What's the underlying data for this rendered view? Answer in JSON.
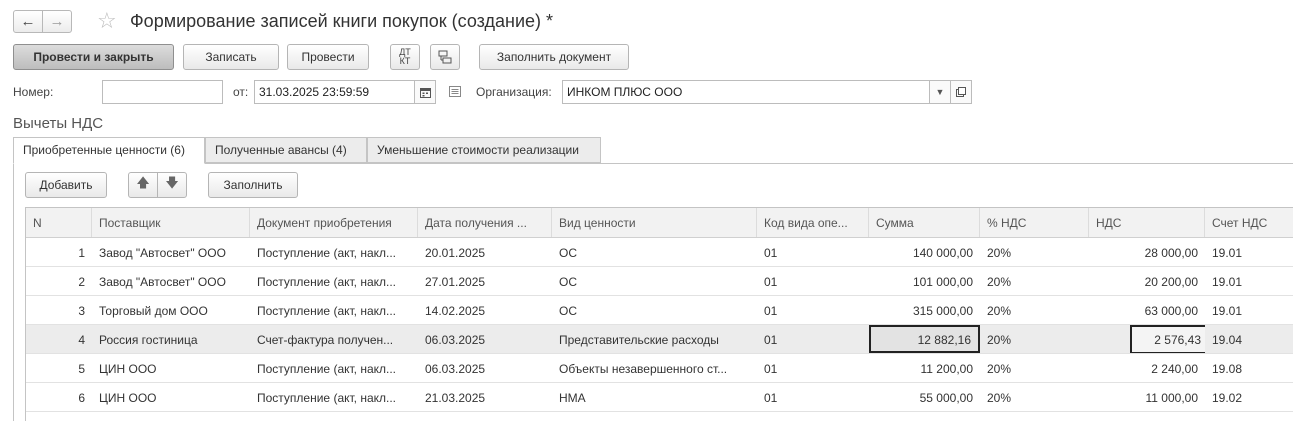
{
  "window": {
    "title": "Формирование записей книги покупок (создание) *"
  },
  "toolbar": {
    "post_close": "Провести и закрыть",
    "save": "Записать",
    "post": "Провести",
    "dtkt": "ДТ КТ",
    "fill_document": "Заполнить документ"
  },
  "form": {
    "number_label": "Номер:",
    "number_value": "",
    "date_label": "от:",
    "date_value": "31.03.2025 23:59:59",
    "org_label": "Организация:",
    "org_value": "ИНКОМ ПЛЮС ООО"
  },
  "section": {
    "title": "Вычеты НДС"
  },
  "tabs": [
    {
      "label": "Приобретенные ценности (6)",
      "active": true
    },
    {
      "label": "Полученные авансы (4)",
      "active": false
    },
    {
      "label": "Уменьшение стоимости реализации",
      "active": false
    }
  ],
  "tab_toolbar": {
    "add": "Добавить",
    "fill": "Заполнить"
  },
  "table": {
    "columns": [
      "N",
      "Поставщик",
      "Документ приобретения",
      "Дата получения ...",
      "Вид ценности",
      "Код вида опе...",
      "Сумма",
      "% НДС",
      "НДС",
      "Счет НДС"
    ],
    "rows": [
      {
        "n": "1",
        "supplier": "Завод \"Автосвет\" ООО",
        "document": "Поступление (акт, накл...",
        "date": "20.01.2025",
        "kind": "ОС",
        "code": "01",
        "sum": "140 000,00",
        "pct": "20%",
        "vat": "28 000,00",
        "account": "19.01"
      },
      {
        "n": "2",
        "supplier": "Завод \"Автосвет\" ООО",
        "document": "Поступление (акт, накл...",
        "date": "27.01.2025",
        "kind": "ОС",
        "code": "01",
        "sum": "101 000,00",
        "pct": "20%",
        "vat": "20 200,00",
        "account": "19.01"
      },
      {
        "n": "3",
        "supplier": "Торговый дом ООО",
        "document": "Поступление (акт, накл...",
        "date": "14.02.2025",
        "kind": "ОС",
        "code": "01",
        "sum": "315 000,00",
        "pct": "20%",
        "vat": "63 000,00",
        "account": "19.01"
      },
      {
        "n": "4",
        "supplier": "Россия гостиница",
        "document": "Счет-фактура получен...",
        "date": "06.03.2025",
        "kind": "Представительские расходы",
        "code": "01",
        "sum": "12 882,16",
        "pct": "20%",
        "vat": "2 576,43",
        "account": "19.04"
      },
      {
        "n": "5",
        "supplier": "ЦИН ООО",
        "document": "Поступление (акт, накл...",
        "date": "06.03.2025",
        "kind": "Объекты незавершенного ст...",
        "code": "01",
        "sum": "11 200,00",
        "pct": "20%",
        "vat": "2 240,00",
        "account": "19.08"
      },
      {
        "n": "6",
        "supplier": "ЦИН ООО",
        "document": "Поступление (акт, накл...",
        "date": "21.03.2025",
        "kind": "НМА",
        "code": "01",
        "sum": "55 000,00",
        "pct": "20%",
        "vat": "11 000,00",
        "account": "19.02"
      }
    ]
  },
  "icons": {
    "back": "arrow-left-icon",
    "forward": "arrow-right-icon",
    "favorite": "star-icon",
    "calendar": "calendar-icon",
    "dropdown": "chevron-down-icon",
    "open": "open-form-icon",
    "move_up": "arrow-up-icon",
    "move_down": "arrow-down-icon"
  }
}
